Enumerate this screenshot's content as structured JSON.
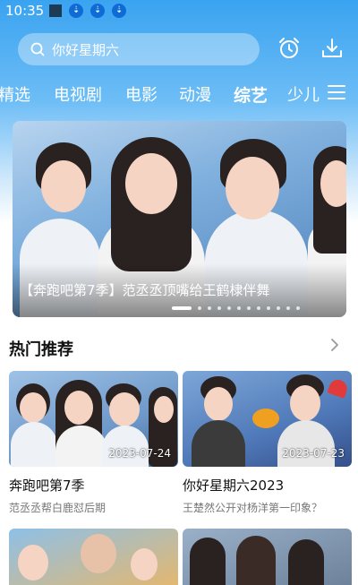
{
  "status_bar": {
    "time": "10:35"
  },
  "search": {
    "text": "你好星期六"
  },
  "tabs": [
    {
      "label": "精选"
    },
    {
      "label": "电视剧"
    },
    {
      "label": "电影"
    },
    {
      "label": "动漫"
    },
    {
      "label": "综艺",
      "active": true
    },
    {
      "label": "少儿"
    }
  ],
  "banner": {
    "caption": "【奔跑吧第7季】范丞丞顶嘴给王鹤棣伴舞",
    "page_count": 12,
    "active_page": 1
  },
  "section": {
    "title": "热门推荐"
  },
  "cards": [
    {
      "date": "2023-07-24",
      "title": "奔跑吧第7季",
      "subtitle": "范丞丞帮白鹿怼后期"
    },
    {
      "date": "2023-07-23",
      "title": "你好星期六2023",
      "subtitle": "王楚然公开对杨洋第一印象？"
    }
  ],
  "colors": {
    "header_blue": "#3aa3f0",
    "text_primary": "#111111",
    "text_secondary": "#777777"
  }
}
